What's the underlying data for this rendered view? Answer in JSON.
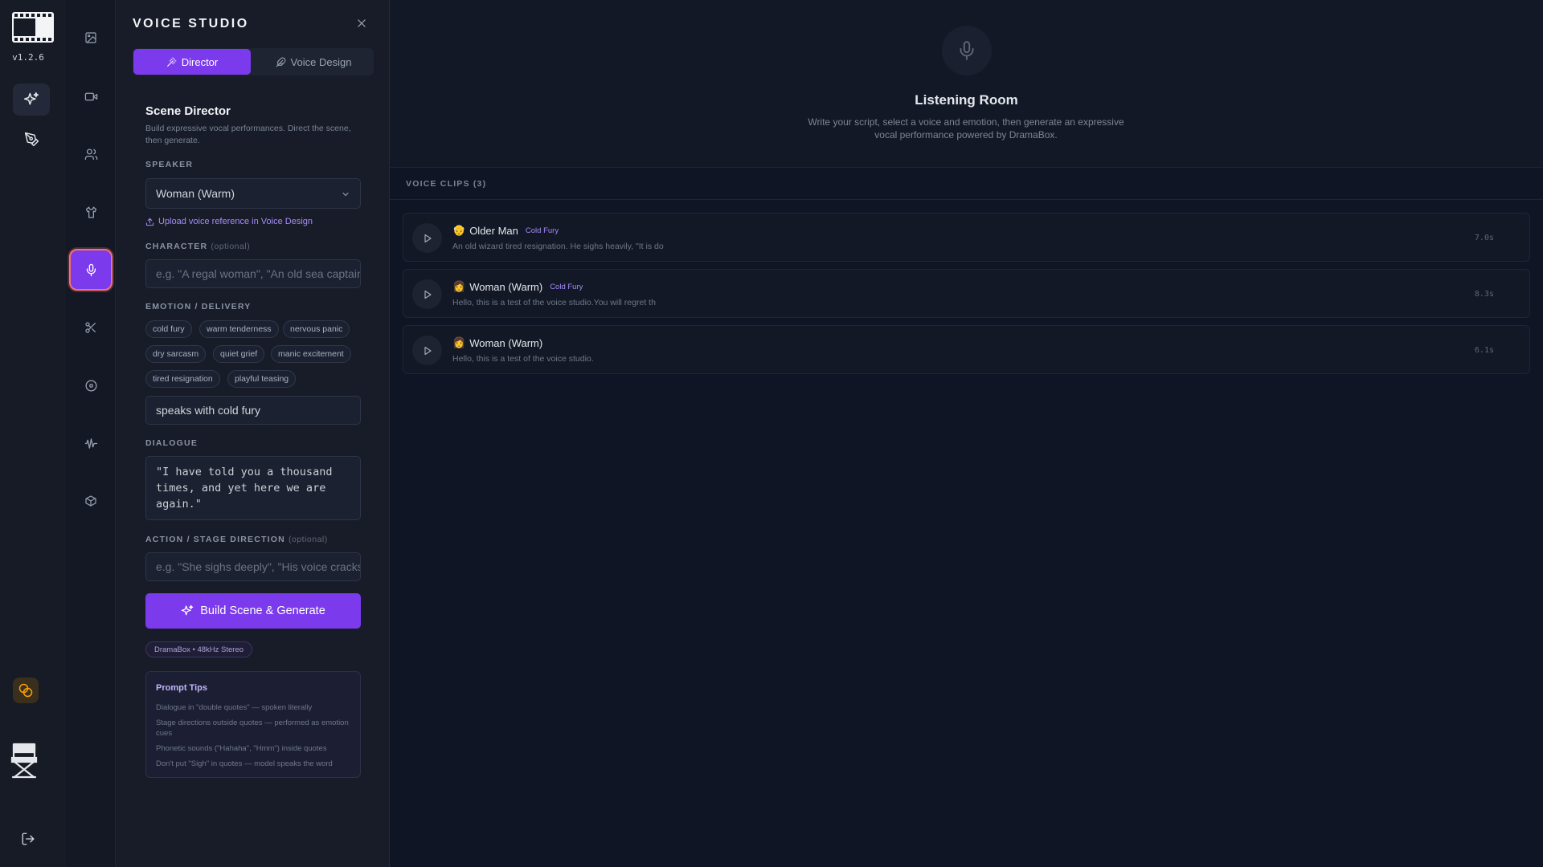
{
  "app": {
    "version": "v1.2.6"
  },
  "panel": {
    "title": "VOICE STUDIO",
    "tabs": [
      {
        "label": "Director",
        "active": true
      },
      {
        "label": "Voice Design",
        "active": false
      }
    ],
    "scene": {
      "title": "Scene Director",
      "description": "Build expressive vocal performances. Direct the scene, then generate."
    },
    "speaker": {
      "label": "SPEAKER",
      "value": "Woman (Warm)",
      "upload_link": "Upload voice reference in Voice Design"
    },
    "character": {
      "label": "CHARACTER",
      "optional": "(optional)",
      "placeholder": "e.g. \"A regal woman\", \"An old sea captain\""
    },
    "emotion": {
      "label": "EMOTION / DELIVERY",
      "chips": [
        "cold fury",
        "warm tenderness",
        "nervous panic",
        "dry sarcasm",
        "quiet grief",
        "manic excitement",
        "tired resignation",
        "playful teasing"
      ],
      "value": "speaks with cold fury"
    },
    "dialogue": {
      "label": "DIALOGUE",
      "value": "\"I have told you a thousand times, and yet here we are again.\""
    },
    "action": {
      "label": "ACTION / STAGE DIRECTION",
      "optional": "(optional)",
      "placeholder": "e.g. \"She sighs deeply\", \"His voice cracks\""
    },
    "generate_button": "Build Scene & Generate",
    "model_badge": "DramaBox • 48kHz Stereo",
    "tips": {
      "title": "Prompt Tips",
      "items": [
        "Dialogue in \"double quotes\" — spoken literally",
        "Stage directions outside quotes — performed as emotion cues",
        "Phonetic sounds (\"Hahaha\", \"Hmm\") inside quotes",
        "Don't put \"Sigh\" in quotes — model speaks the word"
      ]
    }
  },
  "main": {
    "hero": {
      "title": "Listening Room",
      "subtitle": "Write your script, select a voice and emotion, then generate an expressive vocal performance powered by DramaBox."
    },
    "clips_label": "VOICE CLIPS (3)",
    "clips": [
      {
        "emoji": "👴",
        "name": "Older Man",
        "tag": "Cold Fury",
        "text": "An old wizard tired resignation. He sighs heavily, \"It is do",
        "duration": "7.0s"
      },
      {
        "emoji": "👩",
        "name": "Woman (Warm)",
        "tag": "Cold Fury",
        "text": "Hello, this is a test of the voice studio.You will regret th",
        "duration": "8.3s"
      },
      {
        "emoji": "👩",
        "name": "Woman (Warm)",
        "tag": "",
        "text": "Hello, this is a test of the voice studio.",
        "duration": "6.1s"
      }
    ]
  },
  "icons": {
    "rail": [
      "film-logo-icon",
      "sparkles-icon",
      "pen-tool-icon",
      "coins-icon",
      "director-chair-icon",
      "logout-icon"
    ],
    "tools": [
      "image-icon",
      "video-icon",
      "users-icon",
      "shirt-icon",
      "microphone-icon",
      "scissors-icon",
      "disc-icon",
      "waveform-icon",
      "box-icon"
    ]
  },
  "colors": {
    "accent": "#7c3aed",
    "accent_light": "#a78bfa",
    "highlight_border": "#f87171",
    "coin": "#f59e0b"
  }
}
